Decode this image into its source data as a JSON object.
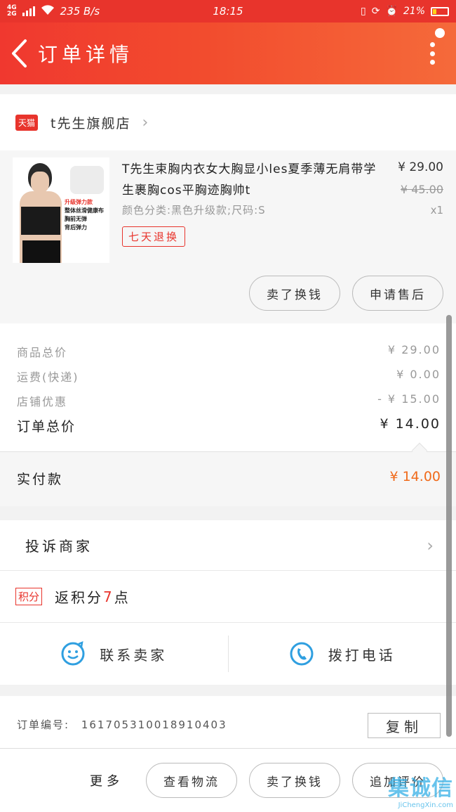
{
  "status_bar": {
    "network": "4G\n2G",
    "speed": "235 B/s",
    "time": "18:15",
    "battery": "21%"
  },
  "header": {
    "title": "订单详情"
  },
  "store": {
    "badge": "天猫",
    "name": "t先生旗舰店"
  },
  "product": {
    "title": "T先生束胸内衣女大胸显小les夏季薄无肩带学生裹胸cos平胸迹胸帅t",
    "spec": "颜色分类:黑色升级款;尺码:S",
    "tag": "七天退换",
    "price": "¥ 29.00",
    "original_price": "¥ 45.00",
    "quantity": "x1",
    "image_callout": [
      "升级弹力款",
      "整体丝滑健康布",
      "胸前无弹",
      "背后弹力"
    ],
    "refund_button": "卖了换钱",
    "aftersale_button": "申请售后"
  },
  "totals": {
    "rows": [
      {
        "label": "商品总价",
        "value": "¥ 29.00"
      },
      {
        "label": "运费(快递)",
        "value": "¥ 0.00"
      },
      {
        "label": "店铺优惠",
        "value": "- ¥ 15.00"
      }
    ],
    "order_total_label": "订单总价",
    "order_total_value": "¥ 14.00",
    "paid_label": "实付款",
    "paid_value": "¥ 14.00"
  },
  "complaint": {
    "label": "投诉商家"
  },
  "points": {
    "badge": "积分",
    "prefix": "返积分",
    "count": "7",
    "suffix": "点"
  },
  "contact": {
    "seller_label": "联系卖家",
    "call_label": "拨打电话"
  },
  "order_info": {
    "order_no_label": "订单编号:",
    "order_no": "1617053100189104​03",
    "copy_label": "复制"
  },
  "bottom_bar": {
    "more_label": "更多",
    "logistics_label": "查看物流",
    "refund_label": "卖了换钱",
    "review_label": "追加评价"
  },
  "watermark": {
    "main": "集诚信",
    "sub": "JiChengXin.com"
  },
  "colors": {
    "accent": "#e8342c",
    "price_paid": "#f06a1a",
    "icon_blue": "#2f9fe0"
  }
}
